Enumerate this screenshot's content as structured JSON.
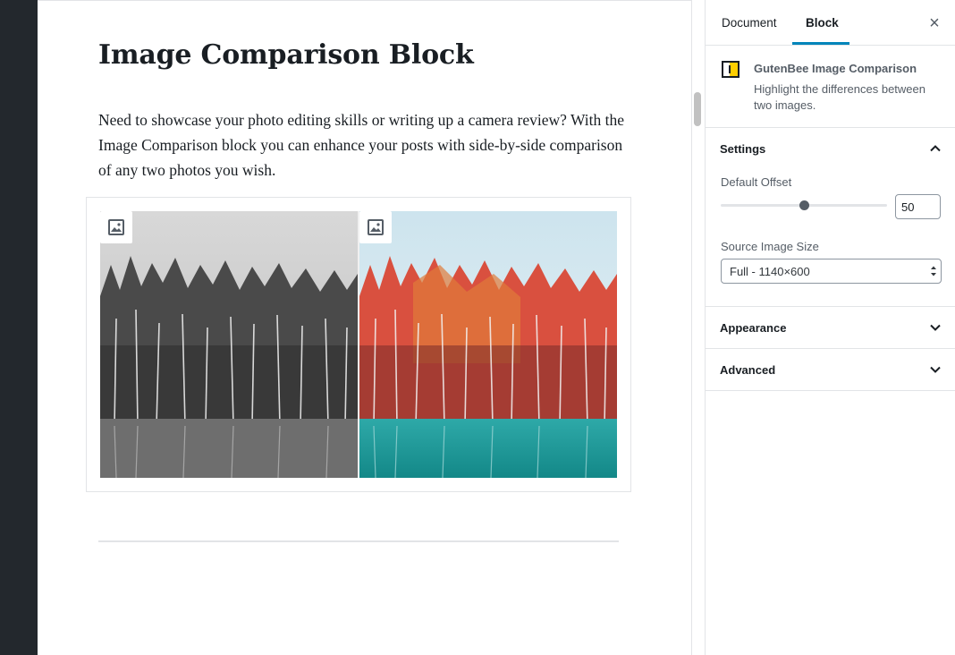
{
  "editor": {
    "title": "Image Comparison Block",
    "paragraph": "Need to showcase your photo editing skills or writing up a camera review? With the Image Comparison block you can enhance your posts with side-by-side comparison of any two photos you wish."
  },
  "sidebar": {
    "tabs": [
      {
        "label": "Document",
        "active": false
      },
      {
        "label": "Block",
        "active": true
      }
    ],
    "close_icon": "close-icon",
    "block": {
      "name": "GutenBee Image Comparison",
      "description": "Highlight the differences between two images.",
      "icon": "image-comparison-icon"
    },
    "panels": {
      "settings": {
        "title": "Settings",
        "expanded": true,
        "default_offset_label": "Default Offset",
        "default_offset_value": "50",
        "default_offset_fraction": 0.5,
        "source_image_size_label": "Source Image Size",
        "source_image_size_value": "Full - 1140×600"
      },
      "appearance": {
        "title": "Appearance",
        "expanded": false
      },
      "advanced": {
        "title": "Advanced",
        "expanded": false
      }
    }
  },
  "colors": {
    "accent": "#0085ba",
    "admin_bar": "#23282d",
    "block_icon_yellow": "#ffcf00"
  }
}
